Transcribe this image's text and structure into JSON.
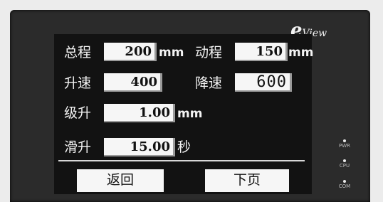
{
  "brand": {
    "prefix": "e",
    "suffix": "View"
  },
  "fields": {
    "total_travel": {
      "label": "总程",
      "value": "200",
      "unit": "mm"
    },
    "moving_travel": {
      "label": "动程",
      "value": "150",
      "unit": "mm"
    },
    "acceleration": {
      "label": "升速",
      "value": "400"
    },
    "deceleration": {
      "label": "降速",
      "value": "600"
    },
    "step_up": {
      "label": "级升",
      "value": "1.00",
      "unit": "mm"
    },
    "slide_up": {
      "label": "滑升",
      "value": "15.00",
      "unit": "秒"
    }
  },
  "buttons": {
    "back": "返回",
    "next_page": "下页"
  },
  "indicators": {
    "power": "PWR",
    "cpu": "CPU",
    "com": "COM"
  }
}
